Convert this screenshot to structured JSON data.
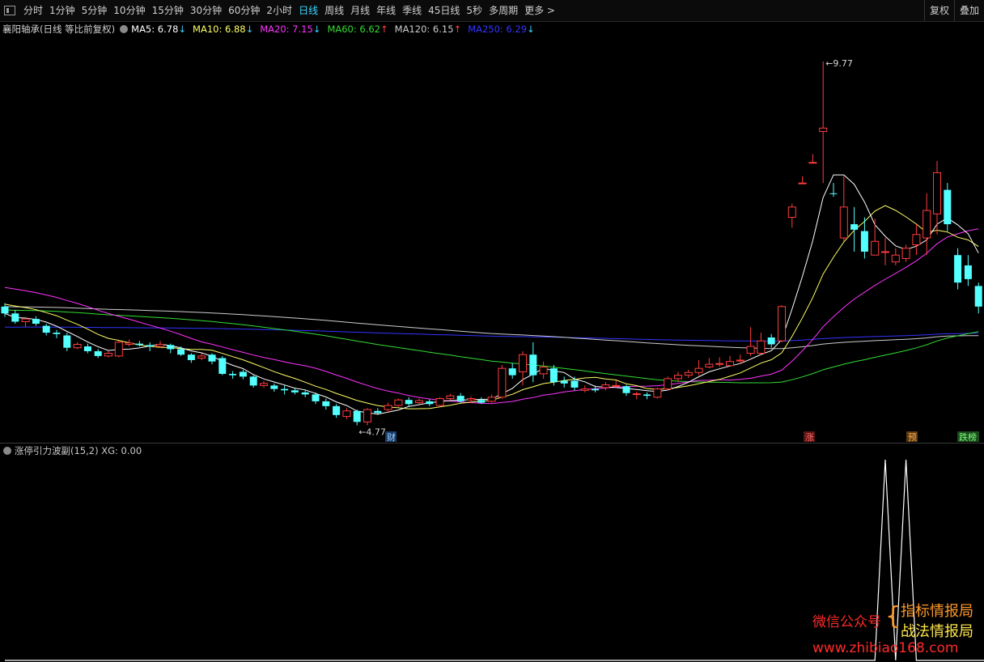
{
  "toolbar": {
    "periods": [
      "分时",
      "1分钟",
      "5分钟",
      "10分钟",
      "15分钟",
      "30分钟",
      "60分钟",
      "2小时",
      "日线",
      "周线",
      "月线",
      "年线",
      "季线",
      "45日线",
      "5秒",
      "多周期",
      "更多 >"
    ],
    "active_index": 8,
    "restore_label": "复权",
    "overlay_label": "叠加"
  },
  "legend": {
    "title": "襄阳轴承(日线 等比前复权)",
    "ma": [
      {
        "label": "MA5: 6.78",
        "arrow": "↓",
        "color": "#ffffff",
        "arrow_color": "#3ad6ff"
      },
      {
        "label": "MA10: 6.88",
        "arrow": "↓",
        "color": "#ffff66",
        "arrow_color": "#3ad6ff"
      },
      {
        "label": "MA20: 7.15",
        "arrow": "↓",
        "color": "#ff33ff",
        "arrow_color": "#3ad6ff"
      },
      {
        "label": "MA60: 6.62",
        "arrow": "↑",
        "color": "#33dd33",
        "arrow_color": "#ff4040"
      },
      {
        "label": "MA120: 6.15",
        "arrow": "↑",
        "color": "#cccccc",
        "arrow_color": "#ff4040"
      },
      {
        "label": "MA250: 6.29",
        "arrow": "↓",
        "color": "#3333ff",
        "arrow_color": "#3ad6ff"
      }
    ]
  },
  "indicator": {
    "legend": "涨停引力波副(15,2)  XG: 0.00",
    "xg_series": [
      0,
      0,
      0,
      0,
      0,
      0,
      0,
      0,
      0,
      0,
      0,
      0,
      0,
      0,
      0,
      0,
      0,
      0,
      0,
      0,
      0,
      0,
      0,
      0,
      0,
      0,
      0,
      0,
      0,
      0,
      0,
      0,
      0,
      0,
      0,
      0,
      0,
      0,
      0,
      0,
      0,
      0,
      0,
      0,
      0,
      0,
      0,
      0,
      0,
      0,
      0,
      0,
      0,
      0,
      0,
      0,
      0,
      0,
      0,
      0,
      0,
      0,
      0,
      0,
      0,
      0,
      0,
      0,
      0,
      0,
      0,
      0,
      0,
      0,
      0,
      0,
      0,
      0,
      0,
      0,
      0,
      0,
      0,
      0,
      0,
      1,
      0,
      1,
      0,
      0,
      0,
      0,
      0,
      0,
      0,
      0
    ]
  },
  "markers": {
    "low_label": "4.77",
    "high_label": "9.77",
    "cai": "财",
    "zhang": "涨",
    "yu": "预",
    "dieban": "跌榜"
  },
  "watermark": {
    "wechat": "微信公众号",
    "name1": "指标情报局",
    "name2": "战法情报局",
    "site": "www.zhibiao168.com"
  },
  "chart_data": {
    "type": "candlestick",
    "title": "襄阳轴承(日线 等比前复权)",
    "ylim": [
      4.3,
      10.1
    ],
    "series_colors": {
      "up": "#ff3c3c",
      "down": "#54ffff"
    },
    "candles": [
      [
        6.2,
        6.1,
        6.25,
        6.05
      ],
      [
        6.1,
        5.98,
        6.15,
        5.95
      ],
      [
        5.98,
        6.02,
        6.05,
        5.9
      ],
      [
        6.02,
        5.95,
        6.06,
        5.92
      ],
      [
        5.92,
        5.82,
        5.95,
        5.78
      ],
      [
        5.82,
        5.8,
        5.86,
        5.74
      ],
      [
        5.78,
        5.6,
        5.82,
        5.55
      ],
      [
        5.6,
        5.65,
        5.68,
        5.58
      ],
      [
        5.62,
        5.55,
        5.66,
        5.52
      ],
      [
        5.55,
        5.48,
        5.58,
        5.45
      ],
      [
        5.48,
        5.52,
        5.55,
        5.46
      ],
      [
        5.48,
        5.68,
        5.7,
        5.46
      ],
      [
        5.65,
        5.67,
        5.72,
        5.62
      ],
      [
        5.66,
        5.64,
        5.7,
        5.62
      ],
      [
        5.64,
        5.62,
        5.68,
        5.55
      ],
      [
        5.62,
        5.65,
        5.7,
        5.6
      ],
      [
        5.64,
        5.58,
        5.66,
        5.52
      ],
      [
        5.58,
        5.5,
        5.62,
        5.48
      ],
      [
        5.5,
        5.42,
        5.52,
        5.38
      ],
      [
        5.45,
        5.48,
        5.52,
        5.42
      ],
      [
        5.5,
        5.4,
        5.52,
        5.36
      ],
      [
        5.45,
        5.22,
        5.48,
        5.2
      ],
      [
        5.22,
        5.2,
        5.26,
        5.15
      ],
      [
        5.25,
        5.18,
        5.28,
        5.14
      ],
      [
        5.18,
        5.05,
        5.2,
        5.02
      ],
      [
        5.05,
        5.08,
        5.12,
        5.02
      ],
      [
        5.05,
        5.0,
        5.08,
        4.96
      ],
      [
        5.0,
        4.98,
        5.05,
        4.92
      ],
      [
        4.98,
        4.95,
        5.02,
        4.92
      ],
      [
        4.95,
        4.92,
        4.98,
        4.88
      ],
      [
        4.92,
        4.82,
        4.95,
        4.78
      ],
      [
        4.82,
        4.75,
        4.86,
        4.7
      ],
      [
        4.75,
        4.62,
        4.78,
        4.58
      ],
      [
        4.6,
        4.68,
        4.72,
        4.56
      ],
      [
        4.68,
        4.52,
        4.7,
        4.47
      ],
      [
        4.52,
        4.7,
        4.72,
        4.47
      ],
      [
        4.68,
        4.65,
        4.72,
        4.62
      ],
      [
        4.7,
        4.76,
        4.8,
        4.66
      ],
      [
        4.76,
        4.84,
        4.86,
        4.74
      ],
      [
        4.84,
        4.78,
        4.88,
        4.74
      ],
      [
        4.8,
        4.83,
        4.86,
        4.78
      ],
      [
        4.82,
        4.78,
        4.85,
        4.75
      ],
      [
        4.76,
        4.86,
        4.88,
        4.74
      ],
      [
        4.86,
        4.9,
        4.93,
        4.84
      ],
      [
        4.9,
        4.82,
        4.94,
        4.8
      ],
      [
        4.84,
        4.86,
        4.89,
        4.8
      ],
      [
        4.84,
        4.8,
        4.88,
        4.78
      ],
      [
        4.82,
        4.88,
        4.92,
        4.8
      ],
      [
        4.88,
        5.3,
        5.35,
        4.86
      ],
      [
        5.3,
        5.2,
        5.38,
        5.15
      ],
      [
        5.25,
        5.5,
        5.55,
        5.05
      ],
      [
        5.5,
        5.2,
        5.68,
        5.1
      ],
      [
        5.22,
        5.32,
        5.4,
        5.15
      ],
      [
        5.3,
        5.1,
        5.35,
        5.05
      ],
      [
        5.12,
        5.08,
        5.18,
        5.02
      ],
      [
        5.12,
        5.02,
        5.18,
        4.98
      ],
      [
        4.98,
        5.0,
        5.05,
        4.95
      ],
      [
        5.0,
        4.98,
        5.05,
        4.95
      ],
      [
        5.02,
        5.06,
        5.1,
        4.98
      ],
      [
        5.05,
        5.05,
        5.12,
        5.02
      ],
      [
        5.04,
        4.94,
        5.06,
        4.9
      ],
      [
        4.92,
        4.93,
        4.96,
        4.85
      ],
      [
        4.92,
        4.9,
        4.95,
        4.85
      ],
      [
        4.88,
        5.0,
        5.02,
        4.86
      ],
      [
        5.0,
        5.15,
        5.18,
        4.98
      ],
      [
        5.15,
        5.2,
        5.25,
        5.1
      ],
      [
        5.2,
        5.24,
        5.28,
        5.16
      ],
      [
        5.24,
        5.3,
        5.42,
        5.2
      ],
      [
        5.32,
        5.36,
        5.45,
        5.3
      ],
      [
        5.36,
        5.37,
        5.46,
        5.32
      ],
      [
        5.34,
        5.4,
        5.48,
        5.34
      ],
      [
        5.42,
        5.42,
        5.5,
        5.36
      ],
      [
        5.52,
        5.62,
        5.9,
        5.48
      ],
      [
        5.52,
        5.7,
        5.82,
        5.5
      ],
      [
        5.75,
        5.65,
        5.8,
        5.6
      ],
      [
        5.7,
        6.2,
        6.22,
        5.68
      ],
      [
        7.5,
        7.65,
        7.7,
        7.35
      ],
      [
        8.0,
        8.0,
        8.1,
        8.0
      ],
      [
        8.3,
        8.3,
        8.42,
        8.3
      ],
      [
        8.75,
        8.8,
        9.77,
        8.0
      ],
      [
        7.85,
        7.84,
        8.0,
        7.8
      ],
      [
        7.2,
        7.65,
        8.1,
        7.15
      ],
      [
        7.4,
        7.32,
        7.65,
        7.0
      ],
      [
        7.3,
        7.0,
        7.5,
        6.9
      ],
      [
        6.95,
        7.15,
        7.48,
        6.95
      ],
      [
        7.0,
        7.0,
        7.2,
        6.8
      ],
      [
        6.85,
        6.95,
        7.05,
        6.8
      ],
      [
        6.9,
        7.05,
        7.1,
        6.85
      ],
      [
        7.1,
        7.25,
        7.4,
        6.95
      ],
      [
        7.2,
        7.6,
        7.85,
        6.95
      ],
      [
        7.55,
        8.15,
        8.32,
        7.25
      ],
      [
        7.9,
        7.4,
        8.0,
        7.3
      ],
      [
        6.95,
        6.55,
        7.05,
        6.45
      ],
      [
        6.8,
        6.6,
        6.95,
        6.5
      ],
      [
        6.5,
        6.2,
        6.55,
        6.1
      ]
    ],
    "ma5_color": "#ffffff",
    "ma10_color": "#ffff66",
    "ma20_color": "#ff33ff",
    "ma60_color": "#33dd33",
    "ma120_color": "#cccccc",
    "ma250_color": "#3333ff"
  }
}
